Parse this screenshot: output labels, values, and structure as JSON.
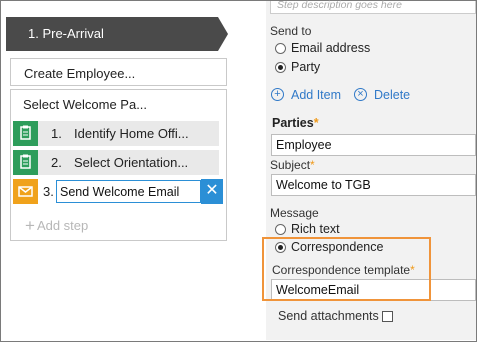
{
  "stage": {
    "label": "1.  Pre-Arrival",
    "color": "#4a4a4a"
  },
  "process_1": {
    "label": "Create Employee..."
  },
  "process_2": {
    "title": "Select Welcome Pa...",
    "steps": [
      {
        "num": "1.",
        "label": "Identify Home Offi...",
        "icon": "clipboard-icon"
      },
      {
        "num": "2.",
        "label": "Select Orientation...",
        "icon": "clipboard-icon"
      },
      {
        "num": "3.",
        "value": "Send Welcome Email",
        "icon": "envelope-icon"
      }
    ],
    "add_step": "Add step"
  },
  "properties": {
    "description_placeholder": "Step description goes here",
    "send_to_label": "Send to",
    "send_to_options": [
      "Email address",
      "Party"
    ],
    "send_to_selected": "Party",
    "add_item": "Add Item",
    "delete": "Delete",
    "parties_label": "Parties",
    "parties_value": "Employee",
    "subject_label": "Subject",
    "subject_value": "Welcome to TGB",
    "message_label": "Message",
    "message_options": [
      "Rich text",
      "Correspondence"
    ],
    "message_selected": "Correspondence",
    "template_label": "Correspondence template",
    "template_value": "WelcomeEmail",
    "attachments_label": "Send attachments",
    "attachments_checked": false
  },
  "colors": {
    "accent_blue": "#2b8fd6",
    "highlight_orange": "#f0943a",
    "required_star": "#f09a1a",
    "green_step": "#2e9d5b",
    "orange_step": "#f0a21b"
  }
}
